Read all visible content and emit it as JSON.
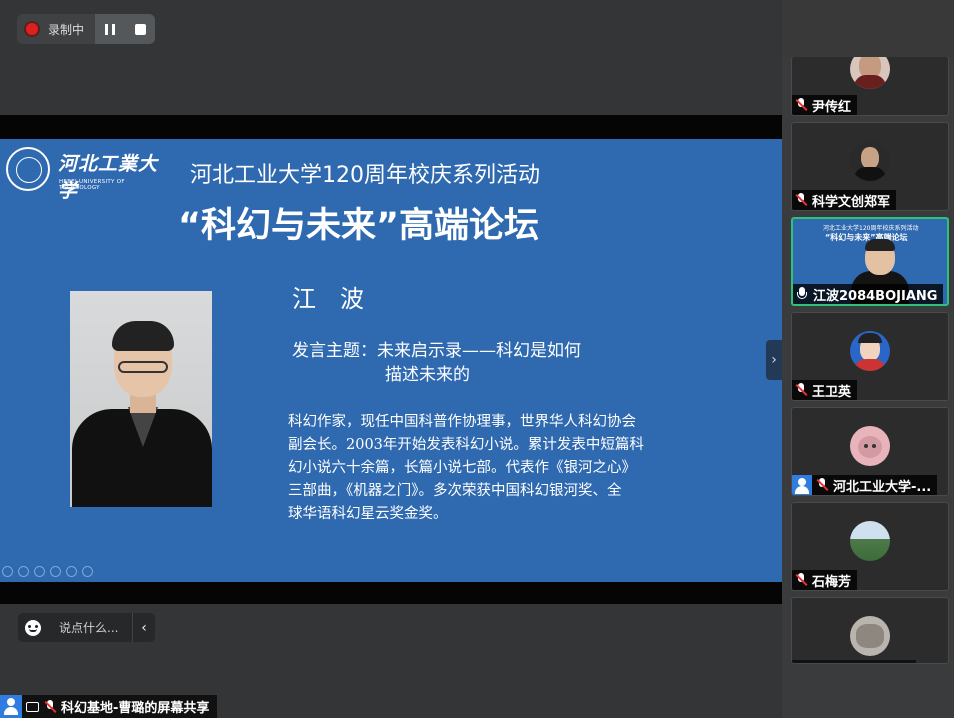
{
  "recording": {
    "label": "录制中"
  },
  "slide": {
    "logo_cn": "河北工業大学",
    "logo_en": "HEBEI UNIVERSITY OF TECHNOLOGY",
    "title_line1": "河北工业大学120周年校庆系列活动",
    "title_line2": "“科幻与未来”高端论坛",
    "speaker_name": "江　波",
    "topic_line1": "发言主题：未来启示录——科幻是如何",
    "topic_line2": "描述未来的",
    "bio_lines": [
      "科幻作家，现任中国科普作协理事，世界华人科幻协会",
      "副会长。2003年开始发表科幻小说。累计发表中短篇科",
      "幻小说六十余篇，长篇小说七部。代表作《银河之心》",
      "三部曲，《机器之门》。多次荣获中国科幻银河奖、全",
      "球华语科幻星云奖金奖。"
    ]
  },
  "chat": {
    "placeholder": "说点什么..."
  },
  "screen_share": {
    "label": "科幻基地-曹璐的屏幕共享"
  },
  "participants": [
    {
      "name": "尹传红",
      "mic": "muted"
    },
    {
      "name": "科学文创郑军",
      "mic": "muted"
    },
    {
      "name": "江波2084BOJIANG",
      "mic": "on",
      "active": true,
      "mini_line1": "河北工业大学120周年校庆系列活动",
      "mini_line2": "“科幻与未来”高端论坛"
    },
    {
      "name": "王卫英",
      "mic": "muted"
    },
    {
      "name": "河北工业大学-...",
      "mic": "muted"
    },
    {
      "name": "石梅芳",
      "mic": "muted"
    },
    {
      "name": "",
      "mic": "none"
    }
  ],
  "colors": {
    "slide_bg": "#2f6ab1",
    "active_border": "#2fc07a",
    "record_dot": "#e02020",
    "share_icon": "#2f7de1"
  }
}
